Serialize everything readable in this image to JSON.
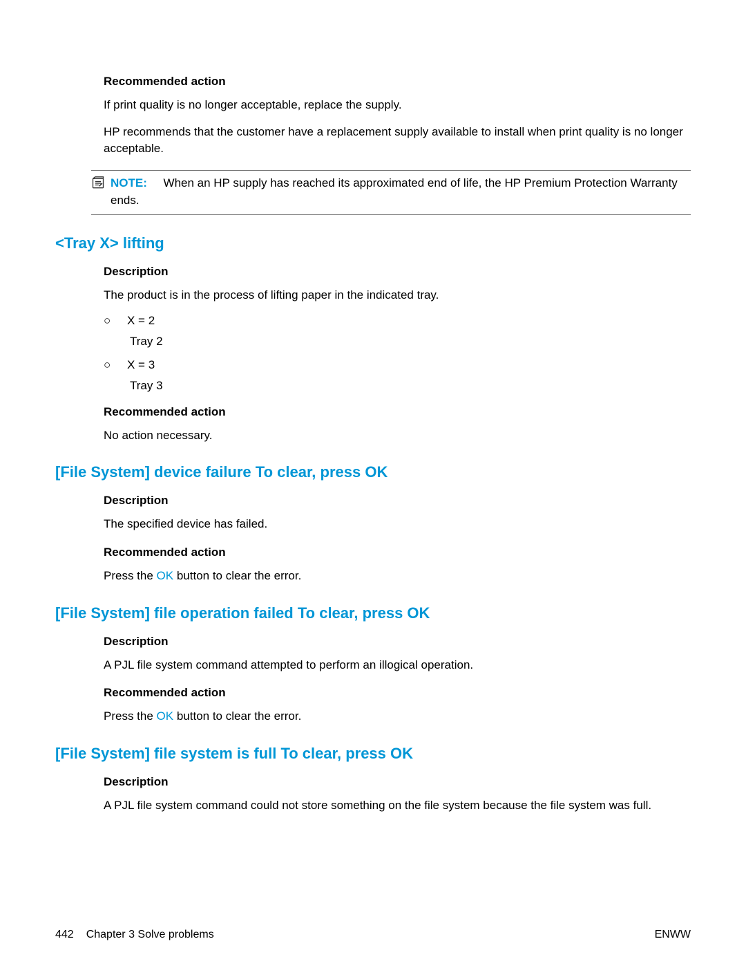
{
  "section1": {
    "rec_action_heading": "Recommended action",
    "rec1": "If print quality is no longer acceptable, replace the supply.",
    "rec2": "HP recommends that the customer have a replacement supply available to install when print quality is no longer acceptable."
  },
  "note": {
    "label": "NOTE:",
    "text": "When an HP supply has reached its approximated end of life, the HP Premium Protection Warranty ends."
  },
  "tray": {
    "title": "<Tray X> lifting",
    "desc_heading": "Description",
    "desc_text": "The product is in the process of lifting paper in the indicated tray.",
    "item1_label": "X = 2",
    "item1_sub": "Tray 2",
    "item2_label": "X = 3",
    "item2_sub": "Tray 3",
    "rec_heading": "Recommended action",
    "rec_text": "No action necessary."
  },
  "fs_device": {
    "title": "[File System] device failure To clear, press OK",
    "desc_heading": "Description",
    "desc_text": "The specified device has failed.",
    "rec_heading": "Recommended action",
    "rec_prefix": "Press the ",
    "ok": "OK",
    "rec_suffix": " button to clear the error."
  },
  "fs_op": {
    "title": "[File System] file operation failed To clear, press OK",
    "desc_heading": "Description",
    "desc_text": "A PJL file system command attempted to perform an illogical operation.",
    "rec_heading": "Recommended action",
    "rec_prefix": "Press the ",
    "ok": "OK",
    "rec_suffix": " button to clear the error."
  },
  "fs_full": {
    "title": "[File System] file system is full To clear, press OK",
    "desc_heading": "Description",
    "desc_text": "A PJL file system command could not store something on the file system because the file system was full."
  },
  "footer": {
    "page_num": "442",
    "chapter": "Chapter 3   Solve problems",
    "right": "ENWW"
  }
}
